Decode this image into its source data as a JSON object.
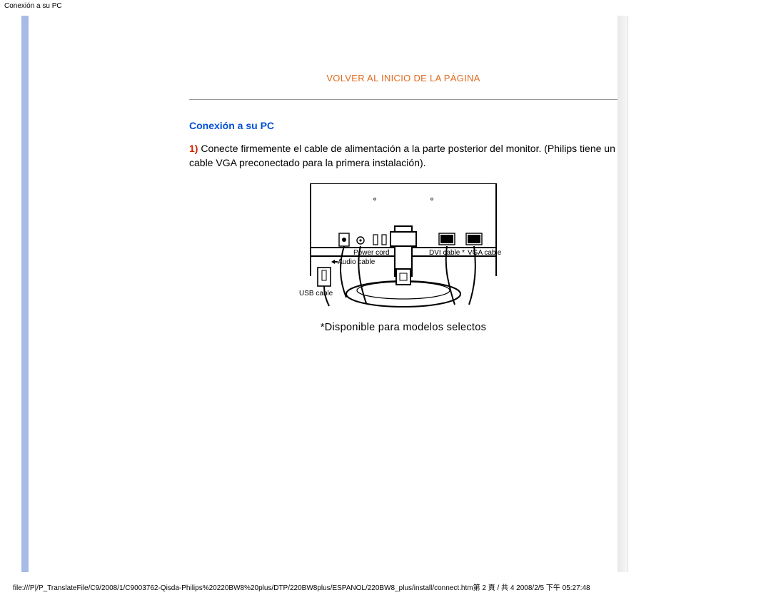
{
  "page_header": "Conexión a su PC",
  "back_to_top": "VOLVER AL INICIO DE LA PÁGINA",
  "section_title": "Conexión a su PC",
  "step_number": "1)",
  "step_text": " Conecte firmemente el cable de alimentación a la parte posterior del monitor. (Philips tiene un cable VGA preconectado para la primera instalación).",
  "diagram_labels": {
    "power_cord": "Power cord",
    "audio_cable": "Audio cable",
    "usb_cable": "USB cable",
    "dvi_cable": "DVI cable *",
    "vga_cable": "VGA cable"
  },
  "caption": "*Disponible para modelos selectos",
  "footer": "file:///P|/P_TranslateFile/C9/2008/1/C9003762-Qisda-Philips%20220BW8%20plus/DTP/220BW8plus/ESPANOL/220BW8_plus/install/connect.htm第 2 頁 / 共 4 2008/2/5 下午 05:27:48"
}
